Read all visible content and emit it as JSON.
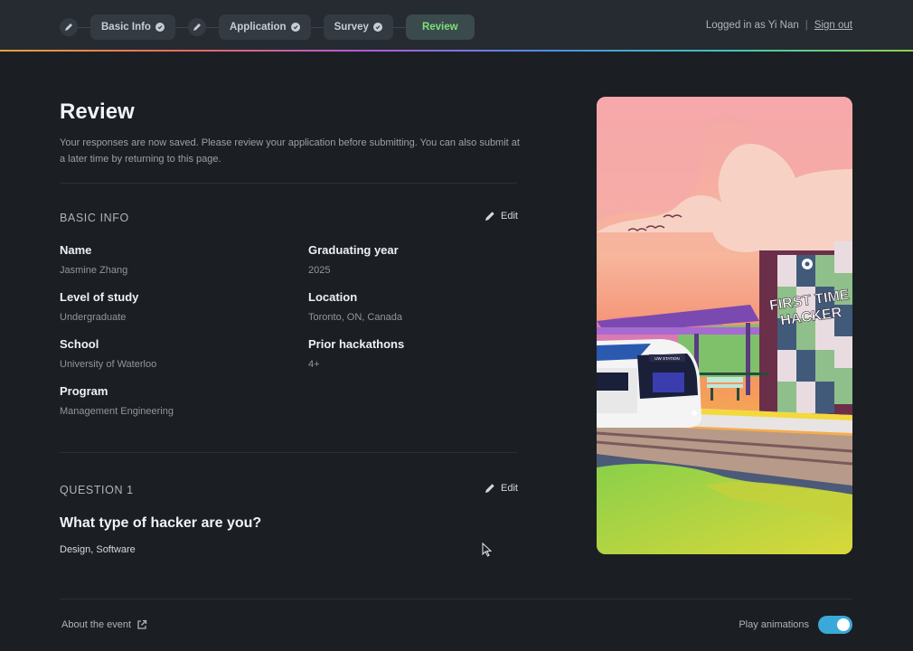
{
  "topbar": {
    "steps": [
      {
        "label": "Basic Info"
      },
      {
        "label": "Application"
      },
      {
        "label": "Survey"
      },
      {
        "label": "Review"
      }
    ],
    "user_text": "Logged in as Yi Nan",
    "separator": "|",
    "signout": "Sign out"
  },
  "page": {
    "title": "Review",
    "intro": "Your responses are now saved. Please review your application before submitting. You can also submit at a later time by returning to this page."
  },
  "basic_info": {
    "title": "BASIC INFO",
    "edit": "Edit",
    "fields": [
      {
        "label": "Name",
        "value": "Jasmine Zhang"
      },
      {
        "label": "Graduating year",
        "value": "2025"
      },
      {
        "label": "Level of study",
        "value": "Undergraduate"
      },
      {
        "label": "Location",
        "value": "Toronto, ON, Canada"
      },
      {
        "label": "School",
        "value": "University of Waterloo"
      },
      {
        "label": "Prior hackathons",
        "value": "4+"
      },
      {
        "label": "Program",
        "value": "Management Engineering"
      }
    ]
  },
  "question1": {
    "title": "QUESTION 1",
    "edit": "Edit",
    "question": "What type of hacker are you?",
    "answer": "Design, Software"
  },
  "illustration": {
    "sign_line1": "FIRST TIME",
    "sign_line2": "HACKER",
    "station_sign": "UW STATION"
  },
  "footer": {
    "about": "About the event",
    "animations_label": "Play animations",
    "animations_on": true
  },
  "colors": {
    "accent_active": "#7ee07a",
    "toggle_on": "#3aa9d8",
    "background": "#1b1f24"
  }
}
